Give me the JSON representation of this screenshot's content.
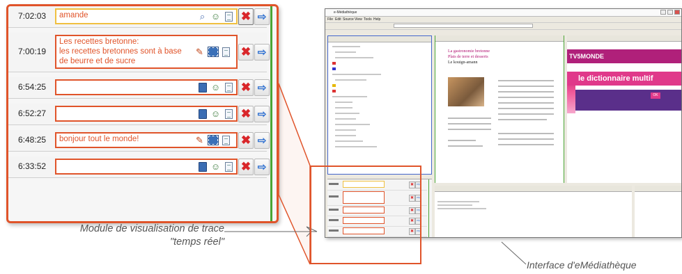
{
  "trace_rows": [
    {
      "time": "7:02:03",
      "text": "amande",
      "box_style": "yellow",
      "icons": [
        "search-person-icon",
        "users-icon",
        "document-icon"
      ],
      "pressed": true
    },
    {
      "time": "7:00:19",
      "text": "Les recettes bretonne:\nles recettes bretonnes sont à base\nde beurre et de sucre",
      "box_style": "orange",
      "icons": [
        "pencil-icon",
        "film-icon",
        "note-icon"
      ],
      "pressed": false
    },
    {
      "time": "6:54:25",
      "text": "",
      "box_style": "orange",
      "icons": [
        "book-icon",
        "users-icon",
        "document-icon"
      ],
      "pressed": false
    },
    {
      "time": "6:52:27",
      "text": "",
      "box_style": "orange",
      "icons": [
        "book-icon",
        "users-icon",
        "document-icon"
      ],
      "pressed": false
    },
    {
      "time": "6:48:25",
      "text": "bonjour tout le monde!",
      "box_style": "orange",
      "icons": [
        "pencil-icon",
        "film-icon",
        "note-icon"
      ],
      "pressed": false
    },
    {
      "time": "6:33:52",
      "text": "",
      "box_style": "orange",
      "icons": [
        "book-icon",
        "users-icon",
        "document-icon"
      ],
      "pressed": false
    }
  ],
  "buttons": {
    "delete_glyph": "✖",
    "goto_glyph": "⇨"
  },
  "app": {
    "document_title": "La gastronomie bretonne",
    "document_subtitle": "Plats de terre et desserts",
    "document_heading": "Le kouign-amann",
    "web_brand": "TV5MONDE",
    "web_banner_text": "le dictionnaire multif",
    "web_ok": "OK"
  },
  "captions": {
    "left": "Module de visualisation de trace \"temps réel\"",
    "right": "Interface d'eMédiathèque"
  },
  "colors": {
    "accent": "#e0542a",
    "green": "#4aa534",
    "blue": "#4466cc",
    "magenta": "#b0207a"
  }
}
